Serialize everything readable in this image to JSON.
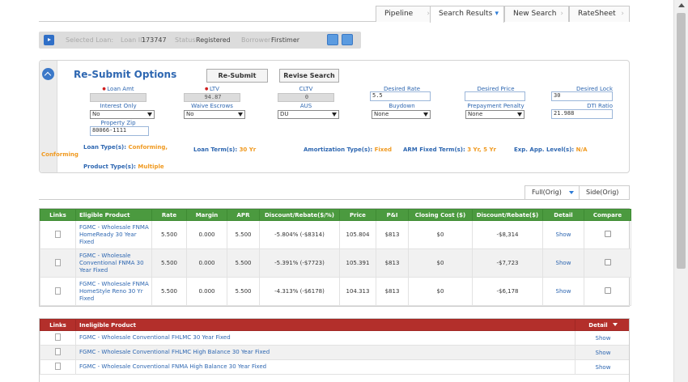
{
  "tabs": [
    {
      "label": "Pipeline",
      "arrow": "›"
    },
    {
      "label": "Search Results",
      "arrow": "▾"
    },
    {
      "label": "New Search",
      "arrow": "›"
    },
    {
      "label": "RateSheet",
      "arrow": "›"
    }
  ],
  "loan_bar": {
    "selected_label": "Selected Loan:",
    "loan_id_label": "Loan ID:",
    "loan_id": "173747",
    "status_label": "Status:",
    "status": "Registered",
    "borrower_label": "Borrower:",
    "borrower": "Firstimer"
  },
  "resubmit": {
    "title": "Re-Submit Options",
    "resubmit_button": "Re-Submit",
    "revise_button": "Revise Search",
    "fields": {
      "loan_amt": {
        "label": "Loan Amt",
        "value": ""
      },
      "ltv": {
        "label": "LTV",
        "value": "94.87"
      },
      "cltv": {
        "label": "CLTV",
        "value": "0"
      },
      "desired_rate": {
        "label": "Desired Rate",
        "value": "5.5"
      },
      "desired_price": {
        "label": "Desired Price",
        "value": ""
      },
      "desired_lock": {
        "label": "Desired Lock",
        "value": "30"
      },
      "interest_only": {
        "label": "Interest Only",
        "value": "No"
      },
      "waive_escrows": {
        "label": "Waive Escrows",
        "value": "No"
      },
      "aus": {
        "label": "AUS",
        "value": "DU"
      },
      "buydown": {
        "label": "Buydown",
        "value": "None"
      },
      "prepay": {
        "label": "Prepayment Penalty",
        "value": "None"
      },
      "dti": {
        "label": "DTI Ratio",
        "value": "21.988"
      },
      "zip": {
        "label": "Property Zip",
        "value": "80066-1111"
      }
    },
    "summary": {
      "loan_types_label": "Loan Type(s):",
      "loan_types_v1": "Conforming,",
      "loan_types_v2": "Conforming",
      "loan_term_label": "Loan Term(s):",
      "loan_term": "30 Yr",
      "amort_label": "Amortization Type(s):",
      "amort": "Fixed",
      "arm_label": "ARM Fixed Term(s):",
      "arm": "3 Yr, 5 Yr",
      "exp_label": "Exp. App. Level(s):",
      "exp": "N/A",
      "product_label": "Product Type(s):",
      "product": "Multiple"
    }
  },
  "view_tabs": {
    "full": "Full(Orig)",
    "side": "Side(Orig)"
  },
  "eligible": {
    "headers": [
      "Links",
      "Eligible Product",
      "Rate",
      "Margin",
      "APR",
      "Discount/Rebate($/%)",
      "Price",
      "P&I",
      "Closing Cost ($)",
      "Discount/Rebate($)",
      "Detail",
      "Compare"
    ],
    "rows": [
      {
        "product": "FGMC - Wholesale FNMA HomeReady 30 Year Fixed",
        "rate": "5.500",
        "margin": "0.000",
        "apr": "5.500",
        "disc_pct": "-5.804% (-$8314)",
        "price": "105.804",
        "pi": "$813",
        "closing": "$0",
        "disc": "-$8,314",
        "detail": "Show"
      },
      {
        "product": "FGMC - Wholesale Conventional FNMA 30 Year Fixed",
        "rate": "5.500",
        "margin": "0.000",
        "apr": "5.500",
        "disc_pct": "-5.391% (-$7723)",
        "price": "105.391",
        "pi": "$813",
        "closing": "$0",
        "disc": "-$7,723",
        "detail": "Show"
      },
      {
        "product": "FGMC - Wholesale FNMA HomeStyle Reno 30 Yr Fixed",
        "rate": "5.500",
        "margin": "0.000",
        "apr": "5.500",
        "disc_pct": "-4.313% (-$6178)",
        "price": "104.313",
        "pi": "$813",
        "closing": "$0",
        "disc": "-$6,178",
        "detail": "Show"
      }
    ]
  },
  "ineligible": {
    "headers": {
      "links": "Links",
      "product": "Ineligible Product",
      "detail": "Detail"
    },
    "rows": [
      {
        "product": "FGMC - Wholesale Conventional FHLMC 30 Year Fixed",
        "detail": "Show"
      },
      {
        "product": "FGMC - Wholesale Conventional FHLMC High Balance 30 Year Fixed",
        "detail": "Show"
      },
      {
        "product": "FGMC - Wholesale Conventional FNMA High Balance 30 Year Fixed",
        "detail": "Show"
      }
    ]
  }
}
